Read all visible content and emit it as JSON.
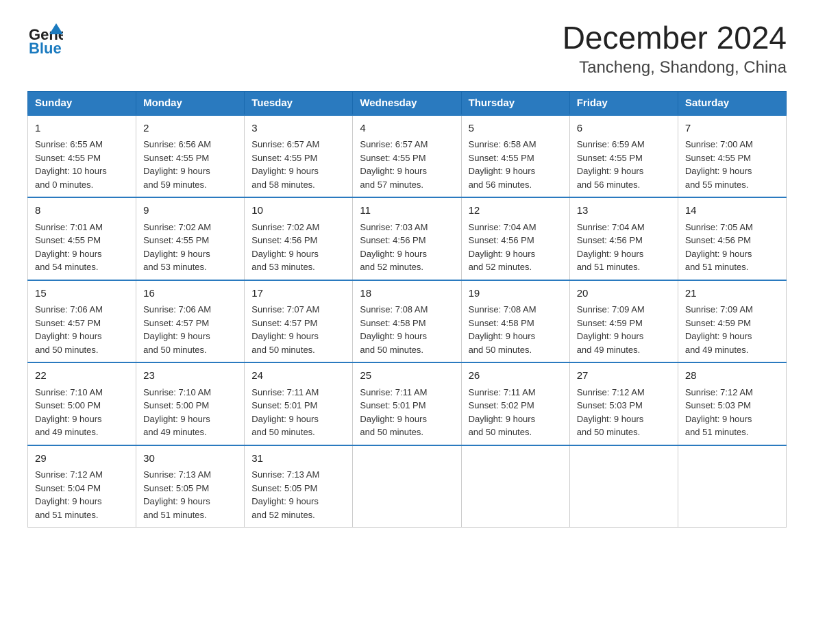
{
  "header": {
    "logo_general": "General",
    "logo_blue": "Blue",
    "title": "December 2024",
    "subtitle": "Tancheng, Shandong, China"
  },
  "columns": [
    "Sunday",
    "Monday",
    "Tuesday",
    "Wednesday",
    "Thursday",
    "Friday",
    "Saturday"
  ],
  "weeks": [
    [
      {
        "day": "1",
        "info": "Sunrise: 6:55 AM\nSunset: 4:55 PM\nDaylight: 10 hours\nand 0 minutes."
      },
      {
        "day": "2",
        "info": "Sunrise: 6:56 AM\nSunset: 4:55 PM\nDaylight: 9 hours\nand 59 minutes."
      },
      {
        "day": "3",
        "info": "Sunrise: 6:57 AM\nSunset: 4:55 PM\nDaylight: 9 hours\nand 58 minutes."
      },
      {
        "day": "4",
        "info": "Sunrise: 6:57 AM\nSunset: 4:55 PM\nDaylight: 9 hours\nand 57 minutes."
      },
      {
        "day": "5",
        "info": "Sunrise: 6:58 AM\nSunset: 4:55 PM\nDaylight: 9 hours\nand 56 minutes."
      },
      {
        "day": "6",
        "info": "Sunrise: 6:59 AM\nSunset: 4:55 PM\nDaylight: 9 hours\nand 56 minutes."
      },
      {
        "day": "7",
        "info": "Sunrise: 7:00 AM\nSunset: 4:55 PM\nDaylight: 9 hours\nand 55 minutes."
      }
    ],
    [
      {
        "day": "8",
        "info": "Sunrise: 7:01 AM\nSunset: 4:55 PM\nDaylight: 9 hours\nand 54 minutes."
      },
      {
        "day": "9",
        "info": "Sunrise: 7:02 AM\nSunset: 4:55 PM\nDaylight: 9 hours\nand 53 minutes."
      },
      {
        "day": "10",
        "info": "Sunrise: 7:02 AM\nSunset: 4:56 PM\nDaylight: 9 hours\nand 53 minutes."
      },
      {
        "day": "11",
        "info": "Sunrise: 7:03 AM\nSunset: 4:56 PM\nDaylight: 9 hours\nand 52 minutes."
      },
      {
        "day": "12",
        "info": "Sunrise: 7:04 AM\nSunset: 4:56 PM\nDaylight: 9 hours\nand 52 minutes."
      },
      {
        "day": "13",
        "info": "Sunrise: 7:04 AM\nSunset: 4:56 PM\nDaylight: 9 hours\nand 51 minutes."
      },
      {
        "day": "14",
        "info": "Sunrise: 7:05 AM\nSunset: 4:56 PM\nDaylight: 9 hours\nand 51 minutes."
      }
    ],
    [
      {
        "day": "15",
        "info": "Sunrise: 7:06 AM\nSunset: 4:57 PM\nDaylight: 9 hours\nand 50 minutes."
      },
      {
        "day": "16",
        "info": "Sunrise: 7:06 AM\nSunset: 4:57 PM\nDaylight: 9 hours\nand 50 minutes."
      },
      {
        "day": "17",
        "info": "Sunrise: 7:07 AM\nSunset: 4:57 PM\nDaylight: 9 hours\nand 50 minutes."
      },
      {
        "day": "18",
        "info": "Sunrise: 7:08 AM\nSunset: 4:58 PM\nDaylight: 9 hours\nand 50 minutes."
      },
      {
        "day": "19",
        "info": "Sunrise: 7:08 AM\nSunset: 4:58 PM\nDaylight: 9 hours\nand 50 minutes."
      },
      {
        "day": "20",
        "info": "Sunrise: 7:09 AM\nSunset: 4:59 PM\nDaylight: 9 hours\nand 49 minutes."
      },
      {
        "day": "21",
        "info": "Sunrise: 7:09 AM\nSunset: 4:59 PM\nDaylight: 9 hours\nand 49 minutes."
      }
    ],
    [
      {
        "day": "22",
        "info": "Sunrise: 7:10 AM\nSunset: 5:00 PM\nDaylight: 9 hours\nand 49 minutes."
      },
      {
        "day": "23",
        "info": "Sunrise: 7:10 AM\nSunset: 5:00 PM\nDaylight: 9 hours\nand 49 minutes."
      },
      {
        "day": "24",
        "info": "Sunrise: 7:11 AM\nSunset: 5:01 PM\nDaylight: 9 hours\nand 50 minutes."
      },
      {
        "day": "25",
        "info": "Sunrise: 7:11 AM\nSunset: 5:01 PM\nDaylight: 9 hours\nand 50 minutes."
      },
      {
        "day": "26",
        "info": "Sunrise: 7:11 AM\nSunset: 5:02 PM\nDaylight: 9 hours\nand 50 minutes."
      },
      {
        "day": "27",
        "info": "Sunrise: 7:12 AM\nSunset: 5:03 PM\nDaylight: 9 hours\nand 50 minutes."
      },
      {
        "day": "28",
        "info": "Sunrise: 7:12 AM\nSunset: 5:03 PM\nDaylight: 9 hours\nand 51 minutes."
      }
    ],
    [
      {
        "day": "29",
        "info": "Sunrise: 7:12 AM\nSunset: 5:04 PM\nDaylight: 9 hours\nand 51 minutes."
      },
      {
        "day": "30",
        "info": "Sunrise: 7:13 AM\nSunset: 5:05 PM\nDaylight: 9 hours\nand 51 minutes."
      },
      {
        "day": "31",
        "info": "Sunrise: 7:13 AM\nSunset: 5:05 PM\nDaylight: 9 hours\nand 52 minutes."
      },
      {
        "day": "",
        "info": ""
      },
      {
        "day": "",
        "info": ""
      },
      {
        "day": "",
        "info": ""
      },
      {
        "day": "",
        "info": ""
      }
    ]
  ]
}
